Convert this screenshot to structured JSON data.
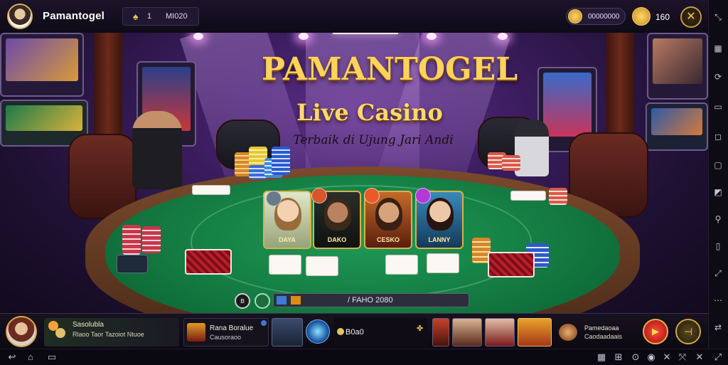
{
  "topbar": {
    "app_title": "Pamantogel",
    "coin_a": "1",
    "coin_b": "MI020",
    "gold_balance": "00000000",
    "gold_count": "160",
    "close_icon": "✕"
  },
  "hero": {
    "brand": "PAMANTOGEL",
    "subtitle": "Live Casino",
    "tagline": "Terbaik di Ujung Jari Andi"
  },
  "dealers": [
    {
      "name": "DAYA",
      "gem_color": "#6a7a8a"
    },
    {
      "name": "DAKO",
      "gem_color": "#d8562a"
    },
    {
      "name": "CESKO",
      "gem_color": "#e85a2a"
    },
    {
      "name": "LANNY",
      "gem_color": "#b23ad8"
    }
  ],
  "table_status": {
    "text": "/ FAHO 2080"
  },
  "bottombar": {
    "user_line1": "Sasolubla",
    "user_line2": "Rlaoo Taor Tazoiot Ntuoe",
    "game_title": "Rana Boralue",
    "game_subtitle": "Causoraoo",
    "bet_text": "B0a0",
    "promo_line1": "Pamedaoaa",
    "promo_line2": "Caodaadaais",
    "clover_icon": "✤",
    "red_button_icon": "▶",
    "gold_button_icon": "⊣"
  },
  "colors": {
    "accent_gold": "#ffd35a",
    "felt_green": "#137a40",
    "scene_purple": "#3a1c5d"
  }
}
